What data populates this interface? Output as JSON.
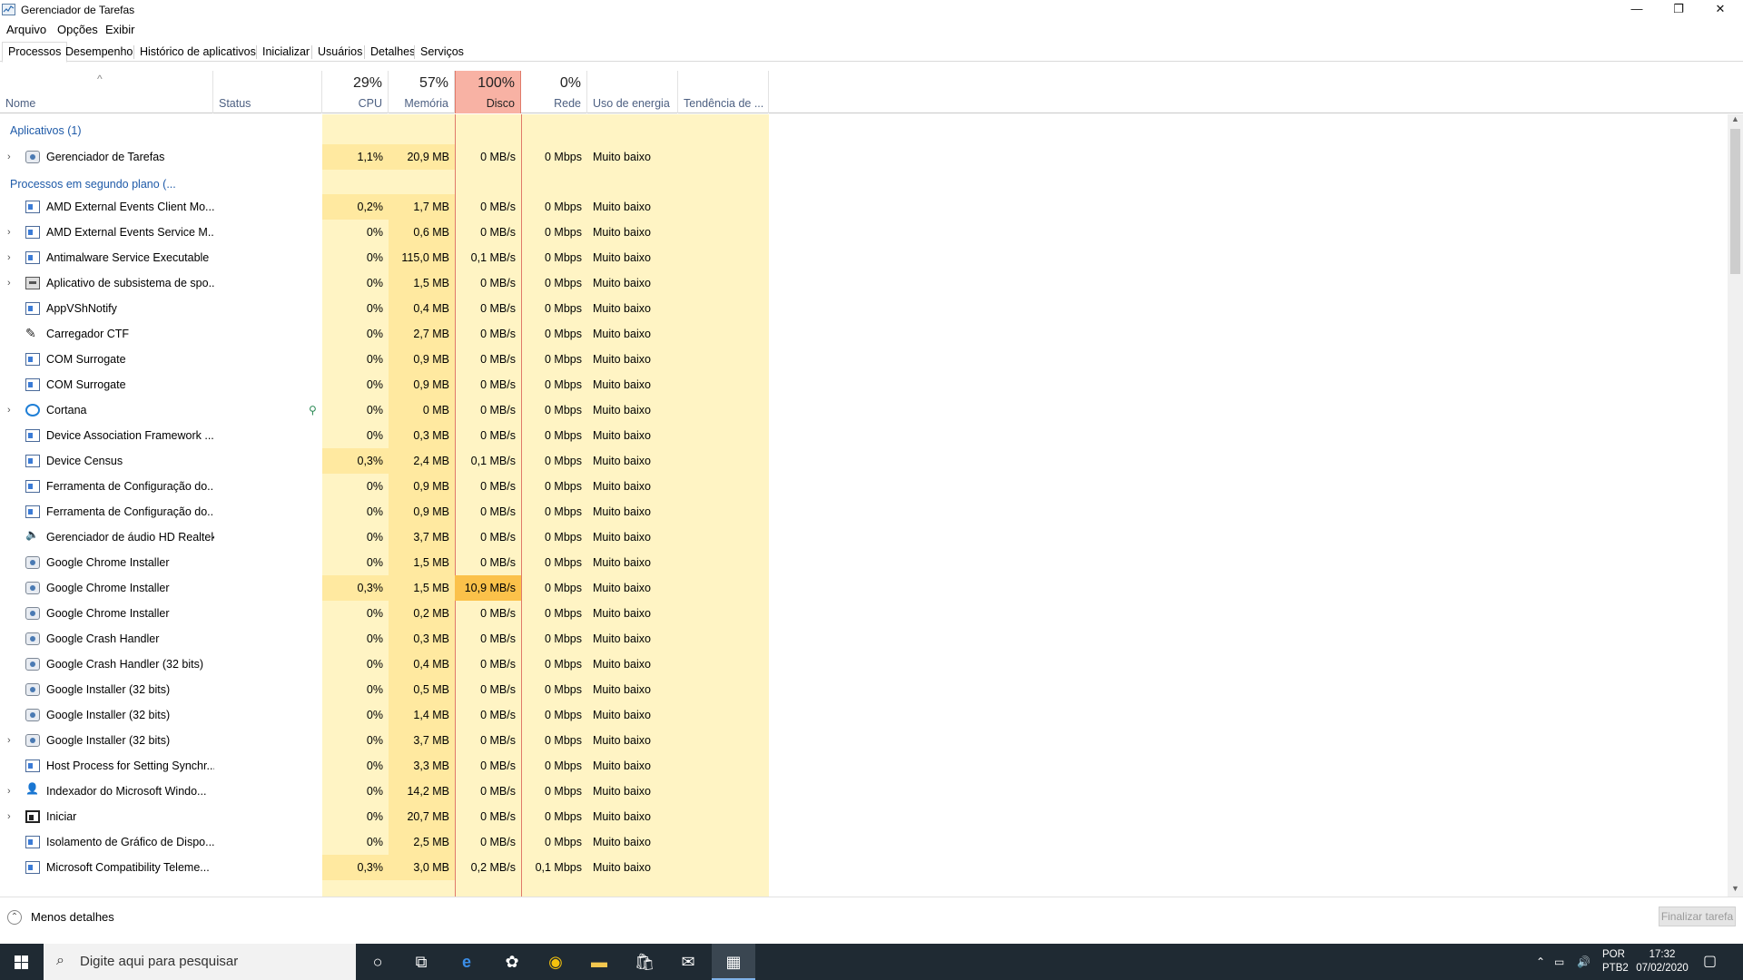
{
  "window": {
    "title": "Gerenciador de Tarefas",
    "controls": {
      "minimize": "—",
      "maximize": "❐",
      "close": "✕"
    }
  },
  "menu": [
    "Arquivo",
    "Opções",
    "Exibir"
  ],
  "tabs": [
    "Processos",
    "Desempenho",
    "Histórico de aplicativos",
    "Inicializar",
    "Usuários",
    "Detalhes",
    "Serviços"
  ],
  "columns": {
    "name": "Nome",
    "status": "Status",
    "cpu": {
      "pct": "29%",
      "label": "CPU"
    },
    "memory": {
      "pct": "57%",
      "label": "Memória"
    },
    "disk": {
      "pct": "100%",
      "label": "Disco"
    },
    "network": {
      "pct": "0%",
      "label": "Rede"
    },
    "power": "Uso de energia",
    "trend": "Tendência de ..."
  },
  "colors": {
    "cell_light": "#fff4c4",
    "cell_mid": "#ffe9a0",
    "disk_header": "#f8b2a4",
    "disk_hot": "#fbc14a",
    "group": "#1e5aa8",
    "taskbar": "#1f2a33"
  },
  "groups": {
    "apps": "Aplicativos (1)",
    "background": "Processos em segundo plano (..."
  },
  "apps": [
    {
      "name": "Gerenciador de Tarefas",
      "cpu": "1,1%",
      "mem": "20,9 MB",
      "disk": "0 MB/s",
      "net": "0 Mbps",
      "power": "Muito baixo",
      "expand": true,
      "icon": "taskmgr-icon"
    }
  ],
  "processes": [
    {
      "name": "AMD External Events Client Mo...",
      "cpu": "0,2%",
      "mem": "1,7 MB",
      "disk": "0 MB/s",
      "net": "0 Mbps",
      "power": "Muito baixo",
      "expand": false,
      "icon": "app-window-icon"
    },
    {
      "name": "AMD External Events Service M...",
      "cpu": "0%",
      "mem": "0,6 MB",
      "disk": "0 MB/s",
      "net": "0 Mbps",
      "power": "Muito baixo",
      "expand": true,
      "icon": "app-window-icon"
    },
    {
      "name": "Antimalware Service Executable",
      "cpu": "0%",
      "mem": "115,0 MB",
      "disk": "0,1 MB/s",
      "net": "0 Mbps",
      "power": "Muito baixo",
      "expand": true,
      "icon": "app-window-icon"
    },
    {
      "name": "Aplicativo de subsistema de spo...",
      "cpu": "0%",
      "mem": "1,5 MB",
      "disk": "0 MB/s",
      "net": "0 Mbps",
      "power": "Muito baixo",
      "expand": true,
      "icon": "printer-icon"
    },
    {
      "name": "AppVShNotify",
      "cpu": "0%",
      "mem": "0,4 MB",
      "disk": "0 MB/s",
      "net": "0 Mbps",
      "power": "Muito baixo",
      "expand": false,
      "icon": "app-window-icon"
    },
    {
      "name": "Carregador CTF",
      "cpu": "0%",
      "mem": "2,7 MB",
      "disk": "0 MB/s",
      "net": "0 Mbps",
      "power": "Muito baixo",
      "expand": false,
      "icon": "ctf-pen-icon"
    },
    {
      "name": "COM Surrogate",
      "cpu": "0%",
      "mem": "0,9 MB",
      "disk": "0 MB/s",
      "net": "0 Mbps",
      "power": "Muito baixo",
      "expand": false,
      "icon": "app-window-icon"
    },
    {
      "name": "COM Surrogate",
      "cpu": "0%",
      "mem": "0,9 MB",
      "disk": "0 MB/s",
      "net": "0 Mbps",
      "power": "Muito baixo",
      "expand": false,
      "icon": "app-window-icon"
    },
    {
      "name": "Cortana",
      "cpu": "0%",
      "mem": "0 MB",
      "disk": "0 MB/s",
      "net": "0 Mbps",
      "power": "Muito baixo",
      "expand": true,
      "icon": "cortana-icon",
      "suspended": true
    },
    {
      "name": "Device Association Framework ...",
      "cpu": "0%",
      "mem": "0,3 MB",
      "disk": "0 MB/s",
      "net": "0 Mbps",
      "power": "Muito baixo",
      "expand": false,
      "icon": "app-window-icon"
    },
    {
      "name": "Device Census",
      "cpu": "0,3%",
      "mem": "2,4 MB",
      "disk": "0,1 MB/s",
      "net": "0 Mbps",
      "power": "Muito baixo",
      "expand": false,
      "icon": "app-window-icon"
    },
    {
      "name": "Ferramenta de Configuração do...",
      "cpu": "0%",
      "mem": "0,9 MB",
      "disk": "0 MB/s",
      "net": "0 Mbps",
      "power": "Muito baixo",
      "expand": false,
      "icon": "app-window-icon"
    },
    {
      "name": "Ferramenta de Configuração do...",
      "cpu": "0%",
      "mem": "0,9 MB",
      "disk": "0 MB/s",
      "net": "0 Mbps",
      "power": "Muito baixo",
      "expand": false,
      "icon": "app-window-icon"
    },
    {
      "name": "Gerenciador de áudio HD Realtek",
      "cpu": "0%",
      "mem": "3,7 MB",
      "disk": "0 MB/s",
      "net": "0 Mbps",
      "power": "Muito baixo",
      "expand": false,
      "icon": "speaker-icon"
    },
    {
      "name": "Google Chrome Installer",
      "cpu": "0%",
      "mem": "1,5 MB",
      "disk": "0 MB/s",
      "net": "0 Mbps",
      "power": "Muito baixo",
      "expand": false,
      "icon": "installer-icon"
    },
    {
      "name": "Google Chrome Installer",
      "cpu": "0,3%",
      "mem": "1,5 MB",
      "disk": "10,9 MB/s",
      "net": "0 Mbps",
      "power": "Muito baixo",
      "expand": false,
      "icon": "installer-icon",
      "disk_hot": true
    },
    {
      "name": "Google Chrome Installer",
      "cpu": "0%",
      "mem": "0,2 MB",
      "disk": "0 MB/s",
      "net": "0 Mbps",
      "power": "Muito baixo",
      "expand": false,
      "icon": "installer-icon"
    },
    {
      "name": "Google Crash Handler",
      "cpu": "0%",
      "mem": "0,3 MB",
      "disk": "0 MB/s",
      "net": "0 Mbps",
      "power": "Muito baixo",
      "expand": false,
      "icon": "installer-icon"
    },
    {
      "name": "Google Crash Handler (32 bits)",
      "cpu": "0%",
      "mem": "0,4 MB",
      "disk": "0 MB/s",
      "net": "0 Mbps",
      "power": "Muito baixo",
      "expand": false,
      "icon": "installer-icon"
    },
    {
      "name": "Google Installer (32 bits)",
      "cpu": "0%",
      "mem": "0,5 MB",
      "disk": "0 MB/s",
      "net": "0 Mbps",
      "power": "Muito baixo",
      "expand": false,
      "icon": "installer-icon"
    },
    {
      "name": "Google Installer (32 bits)",
      "cpu": "0%",
      "mem": "1,4 MB",
      "disk": "0 MB/s",
      "net": "0 Mbps",
      "power": "Muito baixo",
      "expand": false,
      "icon": "installer-icon"
    },
    {
      "name": "Google Installer (32 bits)",
      "cpu": "0%",
      "mem": "3,7 MB",
      "disk": "0 MB/s",
      "net": "0 Mbps",
      "power": "Muito baixo",
      "expand": true,
      "icon": "installer-icon"
    },
    {
      "name": "Host Process for Setting Synchr...",
      "cpu": "0%",
      "mem": "3,3 MB",
      "disk": "0 MB/s",
      "net": "0 Mbps",
      "power": "Muito baixo",
      "expand": false,
      "icon": "app-window-icon"
    },
    {
      "name": "Indexador do Microsoft Windo...",
      "cpu": "0%",
      "mem": "14,2 MB",
      "disk": "0 MB/s",
      "net": "0 Mbps",
      "power": "Muito baixo",
      "expand": true,
      "icon": "person-search-icon"
    },
    {
      "name": "Iniciar",
      "cpu": "0%",
      "mem": "20,7 MB",
      "disk": "0 MB/s",
      "net": "0 Mbps",
      "power": "Muito baixo",
      "expand": true,
      "icon": "start-window-icon"
    },
    {
      "name": "Isolamento de Gráfico de Dispo...",
      "cpu": "0%",
      "mem": "2,5 MB",
      "disk": "0 MB/s",
      "net": "0 Mbps",
      "power": "Muito baixo",
      "expand": false,
      "icon": "app-window-icon"
    },
    {
      "name": "Microsoft Compatibility Teleme...",
      "cpu": "0,3%",
      "mem": "3,0 MB",
      "disk": "0,2 MB/s",
      "net": "0,1 Mbps",
      "power": "Muito baixo",
      "expand": false,
      "icon": "app-window-icon"
    }
  ],
  "footer": {
    "fewer_details": "Menos detalhes",
    "end_task": "Finalizar tarefa"
  },
  "taskbar": {
    "search_placeholder": "Digite aqui para pesquisar",
    "icons": [
      "cortana-circle-icon",
      "task-view-icon",
      "edge-icon",
      "paint-icon",
      "chrome-icon",
      "file-explorer-icon",
      "store-icon",
      "mail-icon",
      "taskmgr-taskbar-icon"
    ],
    "lang_top": "POR",
    "lang_bottom": "PTB2",
    "time": "17:32",
    "date": "07/02/2020"
  }
}
